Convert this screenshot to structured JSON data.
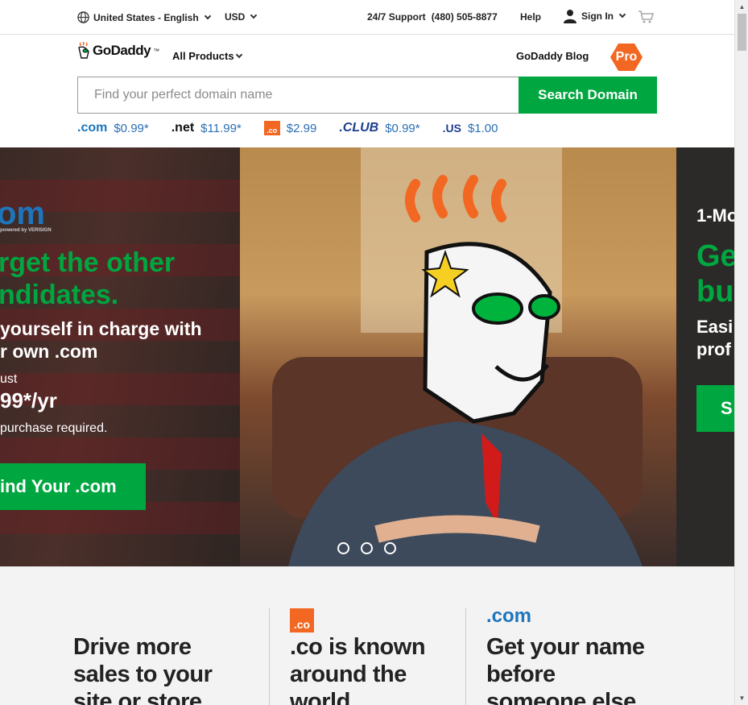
{
  "utility": {
    "locale": "United States - English",
    "currency": "USD",
    "support": "24/7 Support",
    "phone": "(480) 505-8877",
    "help": "Help",
    "sign_in": "Sign In"
  },
  "header": {
    "brand": "GoDaddy",
    "trademark": "™",
    "all_products": "All Products",
    "blog": "GoDaddy Blog",
    "pro": "Pro"
  },
  "search": {
    "placeholder": "Find your perfect domain name",
    "button": "Search Domain"
  },
  "tlds": [
    {
      "name": ".com",
      "price": "$0.99*"
    },
    {
      "name": ".net",
      "price": "$11.99*"
    },
    {
      "name": ".co",
      "price": "$2.99"
    },
    {
      "name": ".CLUB",
      "price": "$0.99*"
    },
    {
      "name": ".US",
      "price": "$1.00"
    }
  ],
  "hero": {
    "left": {
      "logo": "om",
      "verisign": "powered by VERISIGN",
      "headline_1": "rget the other",
      "headline_2": "ndidates.",
      "sub_1": "yourself in charge with",
      "sub_2": "r own .com",
      "just": "ust",
      "price": "99*/yr",
      "purchase": "purchase required.",
      "cta": "ind Your .com"
    },
    "right": {
      "line_1": "1-Mo",
      "line_2": "Ge",
      "line_3": "bu",
      "line_4": "Easi",
      "line_5": "prof",
      "cta": "S"
    },
    "slides": 3
  },
  "features": [
    {
      "title": "Drive more sales to your site or store"
    },
    {
      "icon": ".co",
      "title": ".co is known around the world"
    },
    {
      "icon": ".com",
      "title": "Get your name before someone else"
    }
  ],
  "colors": {
    "accent_green": "#00a63f",
    "brand_orange": "#f26722",
    "com_blue": "#1d75bc",
    "price_blue": "#2b6fb4"
  }
}
